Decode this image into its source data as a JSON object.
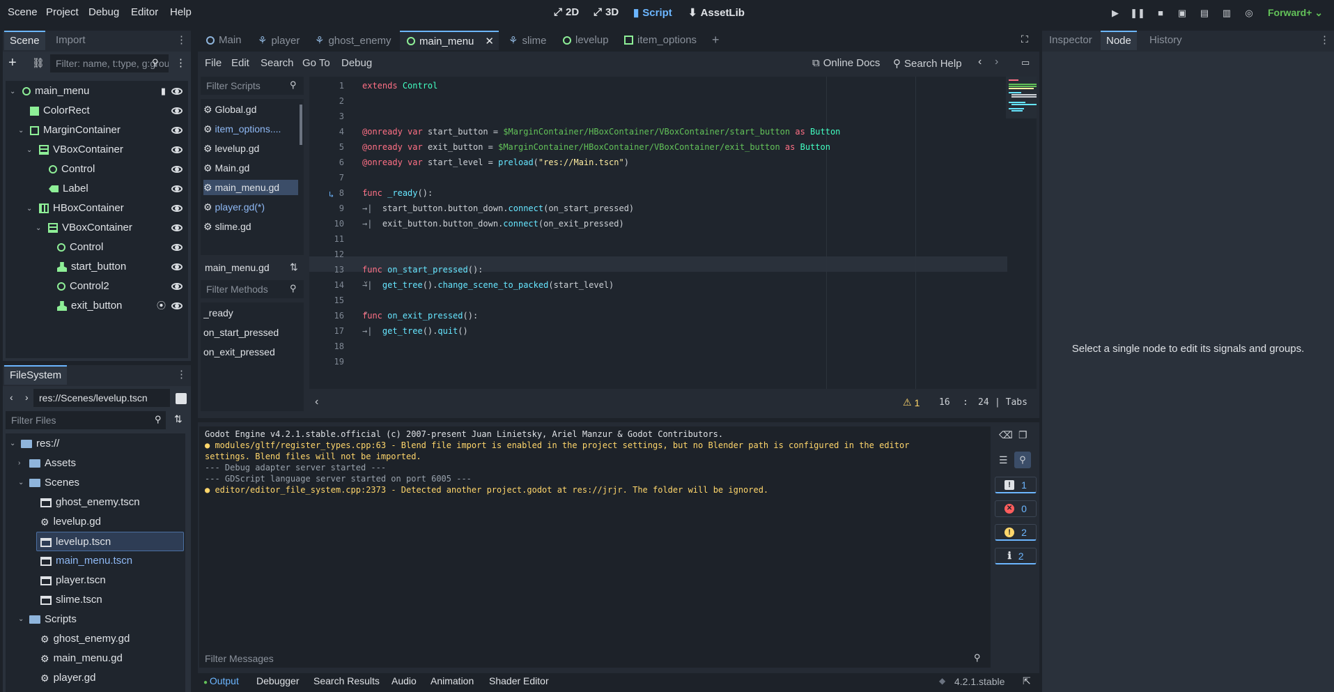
{
  "menubar": {
    "items": [
      "Scene",
      "Project",
      "Debug",
      "Editor",
      "Help"
    ]
  },
  "workspaces": {
    "items": [
      "2D",
      "3D",
      "Script",
      "AssetLib"
    ],
    "active": "Script"
  },
  "renderer": "Forward+",
  "scene_dock": {
    "tabs": [
      "Scene",
      "Import"
    ],
    "filter_placeholder": "Filter: name, t:type, g:group",
    "tree": [
      {
        "label": "main_menu",
        "icon": "control-icon"
      },
      {
        "label": "ColorRect",
        "icon": "colorrect-icon"
      },
      {
        "label": "MarginContainer",
        "icon": "margincontainer-icon"
      },
      {
        "label": "VBoxContainer",
        "icon": "vboxcontainer-icon"
      },
      {
        "label": "Control",
        "icon": "control-icon"
      },
      {
        "label": "Label",
        "icon": "label-icon"
      },
      {
        "label": "HBoxContainer",
        "icon": "hboxcontainer-icon"
      },
      {
        "label": "VBoxContainer",
        "icon": "vboxcontainer-icon"
      },
      {
        "label": "Control",
        "icon": "control-icon"
      },
      {
        "label": "start_button",
        "icon": "button-icon"
      },
      {
        "label": "Control2",
        "icon": "control-icon"
      },
      {
        "label": "exit_button",
        "icon": "button-icon"
      }
    ]
  },
  "filesystem": {
    "tab": "FileSystem",
    "path": "res://Scenes/levelup.tscn",
    "filter_placeholder": "Filter Files",
    "items": [
      {
        "label": "res://",
        "type": "folder"
      },
      {
        "label": "Assets",
        "type": "folder"
      },
      {
        "label": "Scenes",
        "type": "folder"
      },
      {
        "label": "ghost_enemy.tscn",
        "type": "scene"
      },
      {
        "label": "levelup.gd",
        "type": "script"
      },
      {
        "label": "levelup.tscn",
        "type": "scene"
      },
      {
        "label": "main_menu.tscn",
        "type": "scene"
      },
      {
        "label": "player.tscn",
        "type": "scene"
      },
      {
        "label": "slime.tscn",
        "type": "scene"
      },
      {
        "label": "Scripts",
        "type": "folder"
      },
      {
        "label": "ghost_enemy.gd",
        "type": "script"
      },
      {
        "label": "main_menu.gd",
        "type": "script"
      },
      {
        "label": "player.gd",
        "type": "script"
      }
    ]
  },
  "editor_tabs": [
    "Main",
    "player",
    "ghost_enemy",
    "main_menu",
    "slime",
    "levelup",
    "item_options"
  ],
  "active_editor_tab": "main_menu",
  "script_menu": [
    "File",
    "Edit",
    "Search",
    "Go To",
    "Debug"
  ],
  "online_docs": "Online Docs",
  "search_help": "Search Help",
  "scripts": {
    "filter_placeholder": "Filter Scripts",
    "items": [
      "Global.gd",
      "item_options....",
      "levelup.gd",
      "Main.gd",
      "main_menu.gd",
      "player.gd(*)",
      "slime.gd"
    ],
    "current": "main_menu.gd",
    "methods_placeholder": "Filter Methods",
    "methods": [
      "_ready",
      "on_start_pressed",
      "on_exit_pressed"
    ]
  },
  "code_lines": [
    "1",
    "2",
    "3",
    "4",
    "5",
    "6",
    "7",
    "8",
    "9",
    "10",
    "11",
    "12",
    "13",
    "14",
    "15",
    "16",
    "17",
    "18",
    "19"
  ],
  "status": {
    "warnings": "1",
    "line": "16",
    "sep": ":",
    "col": "24",
    "indent": "Tabs"
  },
  "output": {
    "lines": [
      "Godot Engine v4.2.1.stable.official (c) 2007-present Juan Linietsky, Ariel Manzur & Godot Contributors.",
      "modules/gltf/register_types.cpp:63 - Blend file import is enabled in the project settings, but no Blender path is configured in the editor",
      "settings. Blend files will not be imported.",
      "--- Debug adapter server started ---",
      "--- GDScript language server started on port 6005 ---",
      "editor/editor_file_system.cpp:2373 - Detected another project.godot at res://jrjr. The folder will be ignored."
    ],
    "filter_placeholder": "Filter Messages",
    "counts": {
      "messages": "1",
      "errors": "0",
      "warnings": "2",
      "info": "2"
    }
  },
  "bottom_tabs": [
    "Output",
    "Debugger",
    "Search Results",
    "Audio",
    "Animation",
    "Shader Editor"
  ],
  "version": "4.2.1.stable",
  "right_dock": {
    "tabs": [
      "Inspector",
      "Node",
      "History"
    ],
    "message": "Select a single node to edit its signals and groups."
  },
  "colors": {
    "accent": "#6cb6ff",
    "node_green": "#8eef97",
    "warning": "#ffd66b",
    "error": "#ff5d5d"
  }
}
